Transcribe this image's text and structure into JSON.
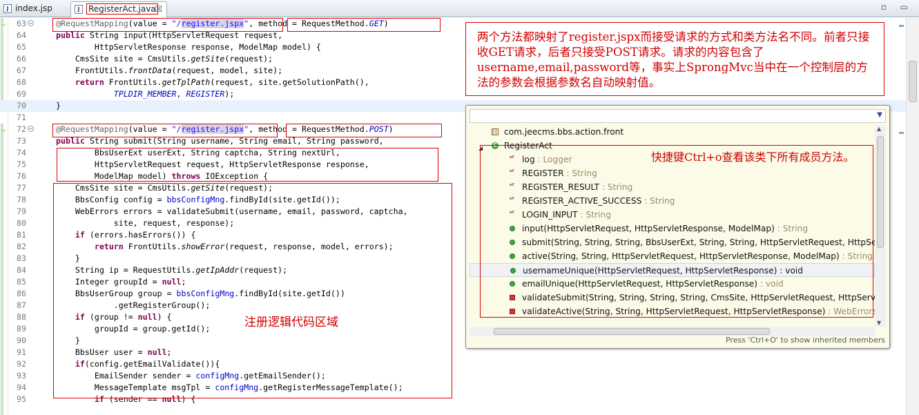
{
  "tabs": [
    {
      "label": "index.jsp",
      "icon": "jsp-file-icon",
      "active": false
    },
    {
      "label": "RegisterAct.java",
      "icon": "java-file-icon",
      "active": true,
      "close": "☒"
    }
  ],
  "window_controls": "▫ ▭",
  "code": [
    {
      "n": "63",
      "html": "<span class=\"ann\">@RequestMapping</span>(value = <span class=\"str\">\"/<span class=\"hl\">register.jspx</span>\"</span>, method = RequestMethod.<span class=\"ifld\">GET</span>)",
      "fold": "⊖",
      "arrow": true
    },
    {
      "n": "64",
      "html": "<span class=\"kw\">public</span> String input(HttpServletRequest request,"
    },
    {
      "n": "65",
      "html": "        HttpServletResponse response, ModelMap model) {"
    },
    {
      "n": "66",
      "html": "    CmsSite site = CmsUtils.<span class=\"ital\">getSite</span>(request);"
    },
    {
      "n": "67",
      "html": "    FrontUtils.<span class=\"ital\">frontData</span>(request, model, site);"
    },
    {
      "n": "68",
      "html": "    <span class=\"kw\">return</span> FrontUtils.<span class=\"ital\">getTplPath</span>(request, site.getSolutionPath(),"
    },
    {
      "n": "69",
      "html": "            <span class=\"ifld\">TPLDIR_MEMBER</span>, <span class=\"ifld\">REGISTER</span>);"
    },
    {
      "n": "70",
      "html": "}",
      "current": true
    },
    {
      "n": "71",
      "html": ""
    },
    {
      "n": "72",
      "html": "<span class=\"ann\">@RequestMapping</span>(value = <span class=\"str\">\"/<span class=\"hl\">register.jspx</span>\"</span>, method = RequestMethod.<span class=\"ifld\">POST</span>)",
      "fold": "⊖",
      "arrow": true
    },
    {
      "n": "73",
      "html": "<span class=\"kw\">public</span> String submit(String username, String email, String password,"
    },
    {
      "n": "74",
      "html": "        BbsUserExt userExt, String captcha, String nextUrl,"
    },
    {
      "n": "75",
      "html": "        HttpServletRequest request, HttpServletResponse response,"
    },
    {
      "n": "76",
      "html": "        ModelMap model) <span class=\"kw\">throws</span> IOException {"
    },
    {
      "n": "77",
      "html": "    CmsSite site = CmsUtils.<span class=\"ital\">getSite</span>(request);"
    },
    {
      "n": "78",
      "html": "    BbsConfig config = <span class=\"fld\">bbsConfigMng</span>.findById(site.getId());"
    },
    {
      "n": "79",
      "html": "    WebErrors errors = validateSubmit(username, email, password, captcha,"
    },
    {
      "n": "80",
      "html": "            site, request, response);"
    },
    {
      "n": "81",
      "html": "    <span class=\"kw\">if</span> (errors.hasErrors()) {"
    },
    {
      "n": "82",
      "html": "        <span class=\"kw\">return</span> FrontUtils.<span class=\"ital\">showError</span>(request, response, model, errors);"
    },
    {
      "n": "83",
      "html": "    }"
    },
    {
      "n": "84",
      "html": "    String ip = RequestUtils.<span class=\"ital\">getIpAddr</span>(request);"
    },
    {
      "n": "85",
      "html": "    Integer groupId = <span class=\"kw\">null</span>;"
    },
    {
      "n": "86",
      "html": "    BbsUserGroup group = <span class=\"fld\">bbsConfigMng</span>.findById(site.getId())"
    },
    {
      "n": "87",
      "html": "            .getRegisterGroup();"
    },
    {
      "n": "88",
      "html": "    <span class=\"kw\">if</span> (group != <span class=\"kw\">null</span>) {"
    },
    {
      "n": "89",
      "html": "        groupId = group.getId();"
    },
    {
      "n": "90",
      "html": "    }"
    },
    {
      "n": "91",
      "html": "    BbsUser user = <span class=\"kw\">null</span>;"
    },
    {
      "n": "92",
      "html": "    <span class=\"kw\">if</span>(config.getEmailValidate()){"
    },
    {
      "n": "93",
      "html": "        EmailSender sender = <span class=\"fld\">configMng</span>.getEmailSender();"
    },
    {
      "n": "94",
      "html": "        MessageTemplate msgTpl = <span class=\"fld\">configMng</span>.getRegisterMessageTemplate();"
    },
    {
      "n": "95",
      "html": "        <span class=\"kw\">if</span> (sender == <span class=\"kw\">null</span>) {"
    }
  ],
  "note_text": "两个方法都映射了register.jspx而接受请求的方式和类方法名不同。前者只接收GET请求，后者只接受POST请求。请求的内容包含了username,email,password等，事实上SprongMvc当中在一个控制层的方法的参数会根据参数名自动映射值。",
  "area_label": "注册逻辑代码区域",
  "outline": {
    "dropdown_icon": "▼",
    "shortcut_note": "快捷键Ctrl+o查看该类下所有成员方法。",
    "status": "Press 'Ctrl+O' to show inherited members",
    "items": [
      {
        "icon": "package-icon",
        "kind": "pkg",
        "indent": 0,
        "label": "com.jeecms.bbs.action.front",
        "type": ""
      },
      {
        "icon": "class-icon",
        "kind": "class",
        "indent": 0,
        "expand": "◢",
        "label": "RegisterAct",
        "type": ""
      },
      {
        "icon": "static-final-field-icon",
        "kind": "sf",
        "indent": 1,
        "label": "log",
        "type": " : Logger"
      },
      {
        "icon": "static-final-field-icon",
        "kind": "sf",
        "indent": 1,
        "label": "REGISTER",
        "type": " : String"
      },
      {
        "icon": "static-final-field-icon",
        "kind": "sf",
        "indent": 1,
        "label": "REGISTER_RESULT",
        "type": " : String"
      },
      {
        "icon": "static-final-field-icon",
        "kind": "sf",
        "indent": 1,
        "label": "REGISTER_ACTIVE_SUCCESS",
        "type": " : String"
      },
      {
        "icon": "static-final-field-icon",
        "kind": "sf",
        "indent": 1,
        "label": "LOGIN_INPUT",
        "type": " : String"
      },
      {
        "icon": "public-method-icon",
        "kind": "pub",
        "indent": 1,
        "label": "input(HttpServletRequest, HttpServletResponse, ModelMap)",
        "type": " : String"
      },
      {
        "icon": "public-method-icon",
        "kind": "pub",
        "indent": 1,
        "label": "submit(String, String, String, BbsUserExt, String, String, HttpServletRequest, HttpServlet",
        "type": ""
      },
      {
        "icon": "public-method-icon",
        "kind": "pub",
        "indent": 1,
        "label": "active(String, String, HttpServletRequest, HttpServletResponse, ModelMap)",
        "type": " : String"
      },
      {
        "icon": "public-method-icon",
        "kind": "pub",
        "indent": 1,
        "label": "usernameUnique(HttpServletRequest, HttpServletResponse)",
        "type": " : void",
        "selected": true
      },
      {
        "icon": "public-method-icon",
        "kind": "pub",
        "indent": 1,
        "label": "emailUnique(HttpServletRequest, HttpServletResponse)",
        "type": " : void"
      },
      {
        "icon": "private-method-icon",
        "kind": "priv",
        "indent": 1,
        "label": "validateSubmit(String, String, String, String, CmsSite, HttpServletRequest, HttpServletRe",
        "type": ""
      },
      {
        "icon": "private-method-icon",
        "kind": "priv",
        "indent": 1,
        "label": "validateActive(String, String, HttpServletRequest, HttpServletResponse)",
        "type": " : WebErrors"
      }
    ]
  }
}
